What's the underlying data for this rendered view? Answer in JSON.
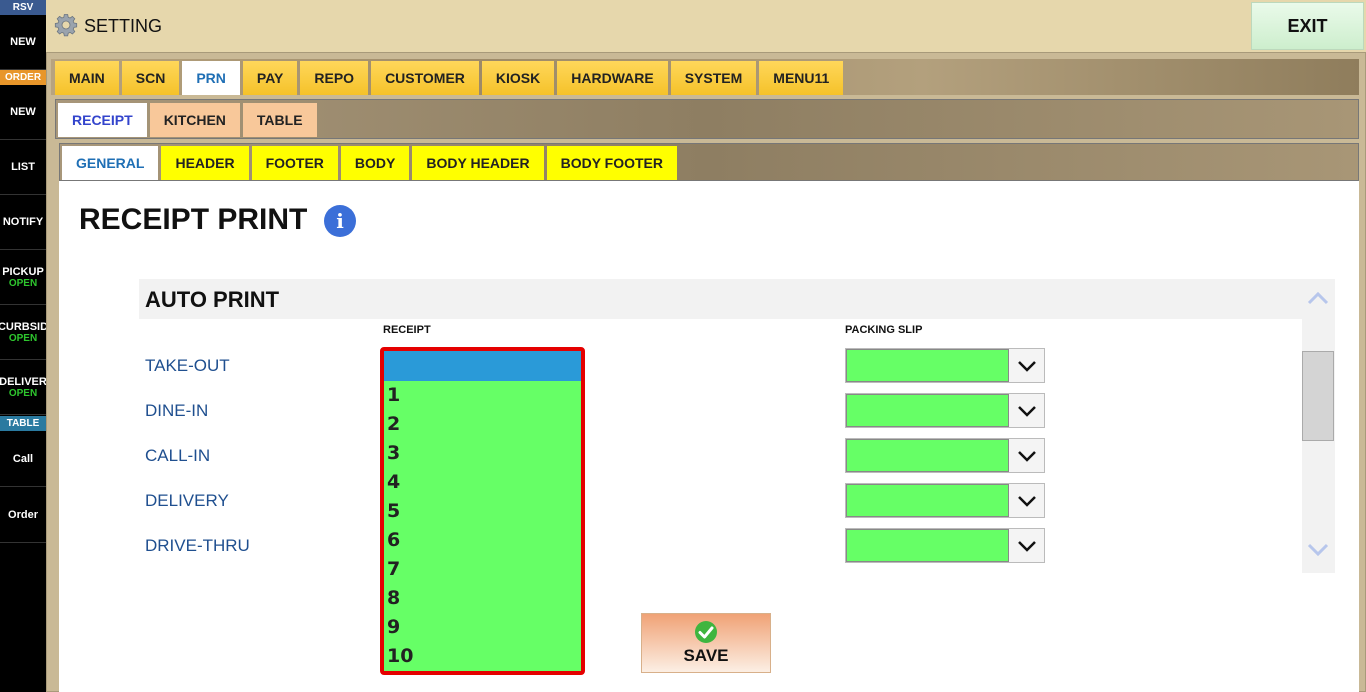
{
  "sidebar": {
    "sections": [
      {
        "label": "RSV",
        "color": "#3a5a90"
      },
      {
        "label": "ORDER",
        "color": "#e8962a"
      },
      {
        "label": "TABLE",
        "color": "#2a7aa0"
      }
    ],
    "items": [
      {
        "label": "NEW",
        "sub": ""
      },
      {
        "label": "NEW",
        "sub": ""
      },
      {
        "label": "LIST",
        "sub": ""
      },
      {
        "label": "NOTIFY",
        "sub": ""
      },
      {
        "label": "PICKUP",
        "sub": "OPEN"
      },
      {
        "label": "CURBSID",
        "sub": "OPEN"
      },
      {
        "label": "DELIVER",
        "sub": "OPEN"
      },
      {
        "label": "Call",
        "sub": ""
      },
      {
        "label": "Order",
        "sub": ""
      }
    ]
  },
  "header": {
    "title": "SETTING",
    "icon": "gear-icon",
    "exit_label": "EXIT"
  },
  "tabs_main": [
    {
      "label": "MAIN",
      "active": false
    },
    {
      "label": "SCN",
      "active": false
    },
    {
      "label": "PRN",
      "active": true
    },
    {
      "label": "PAY",
      "active": false
    },
    {
      "label": "REPO",
      "active": false
    },
    {
      "label": "CUSTOMER",
      "active": false
    },
    {
      "label": "KIOSK",
      "active": false
    },
    {
      "label": "HARDWARE",
      "active": false
    },
    {
      "label": "SYSTEM",
      "active": false
    },
    {
      "label": "MENU11",
      "active": false
    }
  ],
  "tabs_sub": [
    {
      "label": "RECEIPT",
      "active": true
    },
    {
      "label": "KITCHEN",
      "active": false
    },
    {
      "label": "TABLE",
      "active": false
    }
  ],
  "tabs_sub3": [
    {
      "label": "GENERAL",
      "active": true
    },
    {
      "label": "HEADER",
      "active": false
    },
    {
      "label": "FOOTER",
      "active": false
    },
    {
      "label": "BODY",
      "active": false
    },
    {
      "label": "BODY HEADER",
      "active": false
    },
    {
      "label": "BODY FOOTER",
      "active": false
    }
  ],
  "page": {
    "title": "RECEIPT PRINT",
    "info_icon": "i",
    "section_title": "AUTO PRINT",
    "col_receipt": "RECEIPT",
    "col_packing": "PACKING SLIP",
    "rows": [
      "TAKE-OUT",
      "DINE-IN",
      "CALL-IN",
      "DELIVERY",
      "DRIVE-THRU"
    ],
    "receipt_options": [
      "",
      "1",
      "2",
      "3",
      "4",
      "5",
      "6",
      "7",
      "8",
      "9",
      "10"
    ],
    "receipt_selected": "",
    "packing_values": [
      "",
      "",
      "",
      "",
      ""
    ],
    "save_label": "SAVE"
  },
  "colors": {
    "field_green": "#66ff66",
    "highlight_red": "#e50000",
    "selection_blue": "#2a9ad8"
  }
}
